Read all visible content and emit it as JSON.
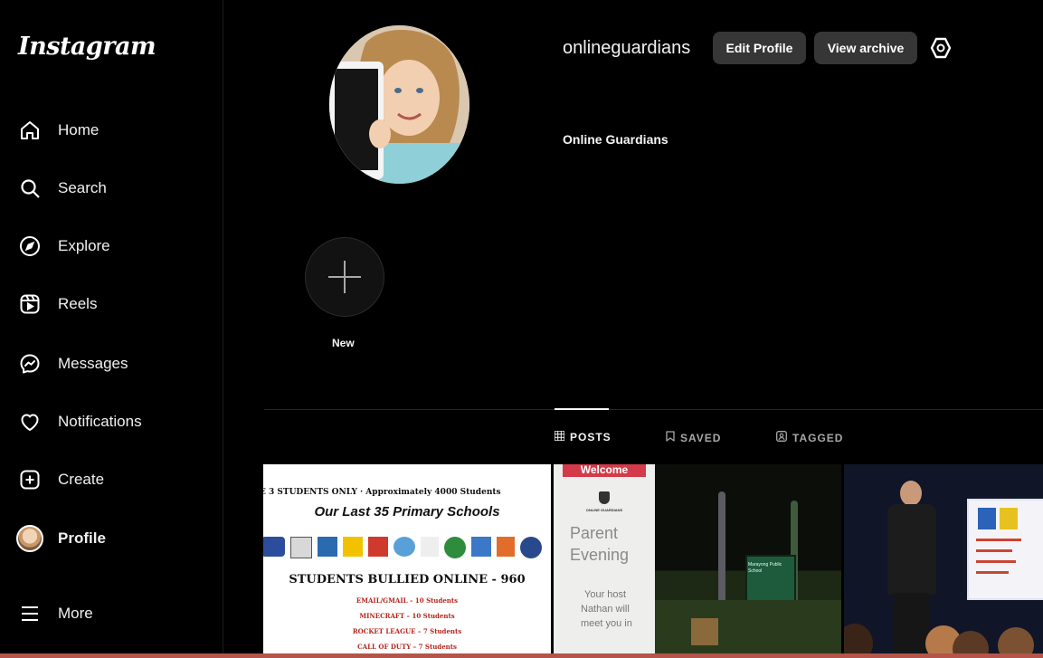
{
  "app": {
    "logo": "Instagram"
  },
  "sidebar": {
    "items": [
      {
        "label": "Home",
        "icon": "home-icon"
      },
      {
        "label": "Search",
        "icon": "search-icon"
      },
      {
        "label": "Explore",
        "icon": "compass-icon"
      },
      {
        "label": "Reels",
        "icon": "reels-icon"
      },
      {
        "label": "Messages",
        "icon": "messenger-icon"
      },
      {
        "label": "Notifications",
        "icon": "heart-icon"
      },
      {
        "label": "Create",
        "icon": "plus-square-icon"
      },
      {
        "label": "Profile",
        "icon": "avatar"
      },
      {
        "label": "More",
        "icon": "menu-icon"
      }
    ]
  },
  "profile": {
    "username": "onlineguardians",
    "edit_label": "Edit Profile",
    "archive_label": "View archive",
    "full_name": "Online Guardians"
  },
  "highlights": {
    "new_label": "New"
  },
  "tabs": [
    {
      "label": "POSTS",
      "icon": "grid-icon",
      "active": true
    },
    {
      "label": "SAVED",
      "icon": "bookmark-icon",
      "active": false
    },
    {
      "label": "TAGGED",
      "icon": "tag-person-icon",
      "active": false
    }
  ],
  "posts": {
    "p1": {
      "header": "E 3 STUDENTS ONLY · Approximately 4000 Students",
      "title": "Our Last 35 Primary Schools",
      "subtitle": "STUDENTS BULLIED ONLINE - 960",
      "lines": [
        "EMAIL/GMAIL – 10 Students",
        "MINECRAFT – 10 Students",
        "ROCKET LEAGUE – 7 Students",
        "CALL OF DUTY – 7 Students"
      ]
    },
    "p2": {
      "banner": "Welcome",
      "brand": "ONLINE GUARDIANS",
      "title_1": "Parent",
      "title_2": "Evening",
      "host_1": "Your host",
      "host_2": "Nathan will",
      "host_3": "meet you in",
      "sign": "Marayong Public School"
    }
  },
  "colors": {
    "accent_bar": "#b5544a",
    "button_bg": "#363636"
  }
}
